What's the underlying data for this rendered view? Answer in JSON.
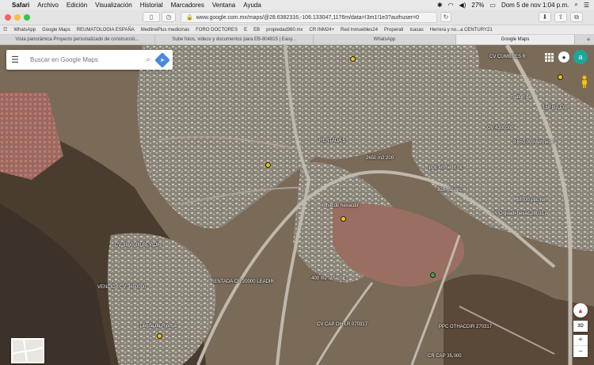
{
  "menubar": {
    "app": "Safari",
    "items": [
      "Archivo",
      "Edición",
      "Visualización",
      "Historial",
      "Marcadores",
      "Ventana",
      "Ayuda"
    ],
    "battery": "27%",
    "datetime": "Dom 5 de nov  1:04 p.m."
  },
  "toolbar": {
    "url": "www.google.com.mx/maps/@28.6382316,-106.133047,1176m/data=!3m1!1e3?authuser=0"
  },
  "bookmarks": [
    "WhatsApp",
    "Google Maps",
    "REUMATOLOGIA ESPAÑA",
    "MedlinePlus medicinas",
    "FORO DOCTORES",
    "E",
    "EB",
    "propiedad360.mx",
    "CR INM24+",
    "Red Inmuebles24",
    "Properati",
    "Icasas",
    "Herrera y no...a CENTURY21"
  ],
  "tabs": [
    {
      "label": "Vista panorámica Proyecto personalizado de construcció...",
      "active": false
    },
    {
      "label": "Sube fotos, videos y documentos para EB-804815 | Easy...",
      "active": false
    },
    {
      "label": "WhatsApp",
      "active": false
    },
    {
      "label": "Google Maps",
      "active": true
    }
  ],
  "search": {
    "placeholder": "Buscar en Google Maps"
  },
  "user": {
    "initial": "a"
  },
  "map_controls": {
    "label_3d": "3D"
  },
  "map_labels": [
    {
      "text": "CV CUMBRES R"
    },
    {
      "text": "Salón de"
    },
    {
      "text": "159 m2 Con"
    },
    {
      "text": "CV 4300000"
    },
    {
      "text": "3,650,000 Arrmedir"
    },
    {
      "text": "RENTADA 5"
    },
    {
      "text": "2650 m2 200"
    },
    {
      "text": "ppc arrmedir dir"
    },
    {
      "text": "328 m2 ppc"
    },
    {
      "text": "$8700 ppc ren"
    },
    {
      "text": "PPC guad. hevac 280317"
    },
    {
      "text": "CV 3850000 BEVIDIR"
    },
    {
      "text": "VENDIDA CV 3650000"
    },
    {
      "text": "RENTADA CR 20000 LEADIR"
    },
    {
      "text": "400 m2 othacdir"
    },
    {
      "text": "CV CAP OH LR 070317"
    },
    {
      "text": "PPC OTHACDIR 270317"
    },
    {
      "text": "CR CAP 35,000"
    },
    {
      "text": "Tienda de Ryvma"
    },
    {
      "text": "othacdir hevacdir"
    }
  ]
}
